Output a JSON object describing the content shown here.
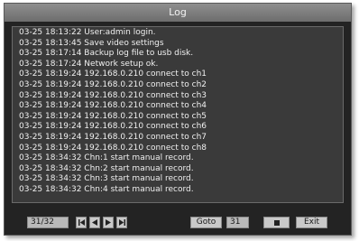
{
  "window": {
    "title": "Log"
  },
  "log": {
    "entries": [
      "03-25 18:13:22 User:admin login.",
      "03-25 18:13:45 Save video settings",
      "03-25 18:17:14 Backup log file to usb disk.",
      "03-25 18:17:24 Network setup ok.",
      "03-25 18:19:24 192.168.0.210 connect to ch1",
      "03-25 18:19:24 192.168.0.210 connect to ch2",
      "03-25 18:19:24 192.168.0.210 connect to ch3",
      "03-25 18:19:24 192.168.0.210 connect to ch4",
      "03-25 18:19:24 192.168.0.210 connect to ch5",
      "03-25 18:19:24 192.168.0.210 connect to ch6",
      "03-25 18:19:24 192.168.0.210 connect to ch7",
      "03-25 18:19:24 192.168.0.210 connect to ch8",
      "03-25 18:34:32 Chn:1 start manual record.",
      "03-25 18:34:32 Chn:2 start manual record.",
      "03-25 18:34:32 Chn:3 start manual record.",
      "03-25 18:34:32 Chn:4 start manual record."
    ]
  },
  "footer": {
    "page_indicator": "31/32",
    "goto_label": "Goto",
    "goto_value": "31",
    "exit_label": "Exit",
    "icons": {
      "first": "first-page-icon",
      "prev": "prev-page-icon",
      "next": "next-page-icon",
      "last": "last-page-icon",
      "stop": "stop-icon"
    }
  },
  "colors": {
    "window_bg": "#232323",
    "titlebar": "#7d7d7d",
    "log_panel_bg": "#3a3a3a",
    "text": "#f0f0f0",
    "button_bg": "#c9c9c9"
  }
}
